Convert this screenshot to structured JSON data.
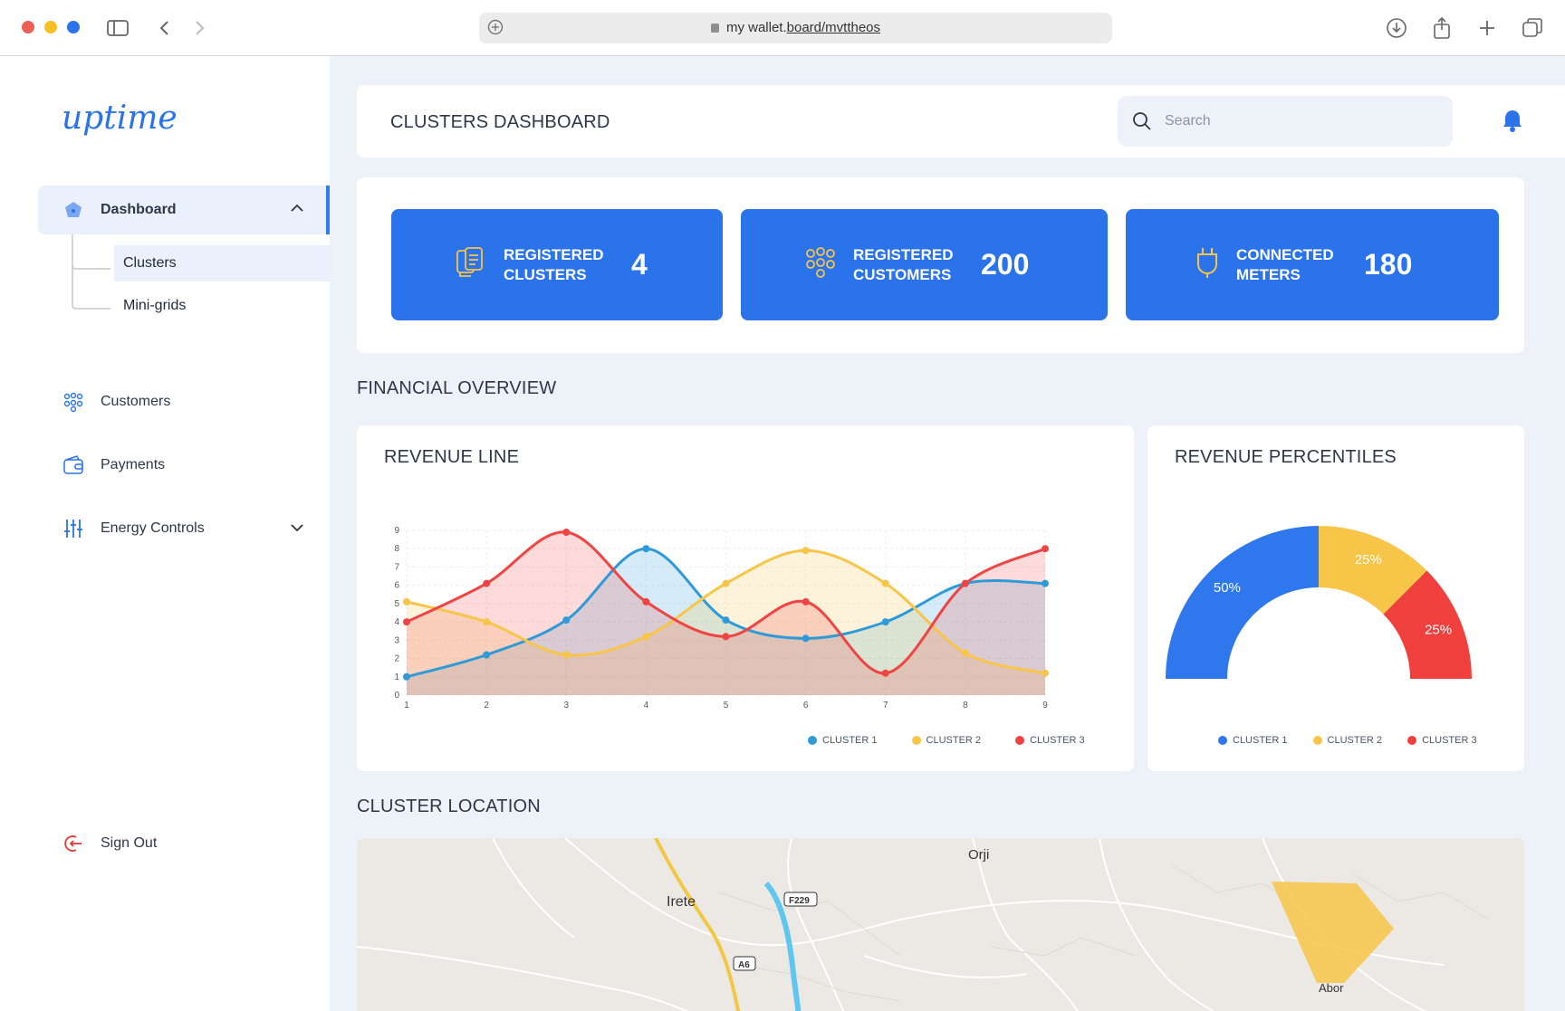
{
  "browser": {
    "url_host": "my wallet.",
    "url_path": "board/mvttheos"
  },
  "sidebar": {
    "logo": "uptime",
    "dashboard": "Dashboard",
    "clusters": "Clusters",
    "minigrids": "Mini-grids",
    "customers": "Customers",
    "payments": "Payments",
    "energy": "Energy Controls",
    "signout": "Sign Out"
  },
  "header": {
    "title": "CLUSTERS DASHBOARD",
    "search_placeholder": "Search"
  },
  "stats": [
    {
      "label_1": "REGISTERED",
      "label_2": "CLUSTERS",
      "value": "4",
      "icon": "clusters-icon"
    },
    {
      "label_1": "REGISTERED",
      "label_2": "CUSTOMERS",
      "value": "200",
      "icon": "customers-icon"
    },
    {
      "label_1": "CONNECTED",
      "label_2": "METERS",
      "value": "180",
      "icon": "plug-icon"
    }
  ],
  "sections": {
    "financial": "FINANCIAL OVERVIEW",
    "location": "CLUSTER LOCATION"
  },
  "cards": {
    "line_title": "REVENUE LINE",
    "pie_title": "REVENUE PERCENTILES"
  },
  "colors": {
    "primary": "#2a73ea",
    "cluster1": "#2f9ad8",
    "cluster2": "#f7c548",
    "cluster3": "#ef4444",
    "pie1": "#2f77ec",
    "pie2": "#f7c548",
    "pie3": "#f0403d"
  },
  "chart_data": [
    {
      "type": "line",
      "title": "REVENUE LINE",
      "x": [
        1,
        2,
        3,
        4,
        5,
        6,
        7,
        8,
        9
      ],
      "y_ticks": [
        0,
        1,
        2,
        3,
        4,
        5,
        6,
        7,
        8,
        9
      ],
      "ylim": [
        0,
        9
      ],
      "grid": true,
      "smooth": true,
      "area_fill": true,
      "legend_position": "bottom-right",
      "series": [
        {
          "name": "CLUSTER 1",
          "values": [
            1,
            2.2,
            4.1,
            8,
            4.1,
            3.1,
            4,
            6.1,
            6.1
          ]
        },
        {
          "name": "CLUSTER 2",
          "values": [
            5.1,
            4,
            2.2,
            3.2,
            6.1,
            7.9,
            6.1,
            2.3,
            1.2
          ]
        },
        {
          "name": "CLUSTER 3",
          "values": [
            4,
            6.1,
            8.9,
            5.1,
            3.2,
            5.1,
            1.2,
            6.1,
            8
          ]
        }
      ]
    },
    {
      "type": "pie",
      "variant": "semi-donut",
      "title": "REVENUE PERCENTILES",
      "legend_position": "bottom",
      "categories": [
        "CLUSTER 1",
        "CLUSTER 2",
        "CLUSTER 3"
      ],
      "values": [
        50,
        25,
        25
      ],
      "labels": [
        "50%",
        "25%",
        "25%"
      ]
    }
  ],
  "map": {
    "labels": [
      "Irete",
      "Orji",
      "F229",
      "A6",
      "Abor"
    ]
  }
}
